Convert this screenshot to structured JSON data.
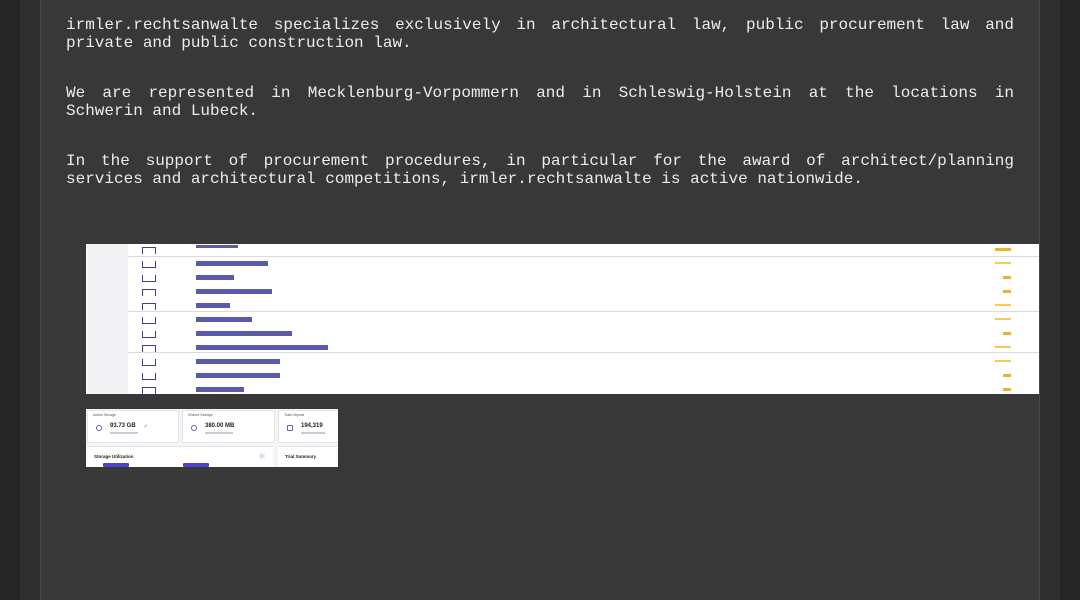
{
  "article": {
    "paragraphs": [
      "irmler.rechtsanwalte specializes exclusively in architectural law, public procurement law and private and public construction law.",
      "We are represented in Mecklenburg-Vorpommern and in Schleswig-Holstein at the locations in Schwerin and Lubeck.",
      "In the support of procurement procedures, in particular for the award of architect/planning services and architectural competitions, irmler.rechtsanwalte is active nationwide."
    ]
  },
  "dashboard_thumb": {
    "cards": [
      {
        "label": "Active Storage",
        "value": "93.73 GB",
        "icon": "cloud-icon"
      },
      {
        "label": "Shared Storage",
        "value": "380.00 MB",
        "icon": "cloud-icon"
      },
      {
        "label": "Total Objects",
        "value": "194,319",
        "icon": "file-icon"
      }
    ],
    "storage_title": "Storage Utilization",
    "trial_title": "Trial Summary"
  },
  "colors": {
    "background": "#383838",
    "text": "#ececec",
    "list_link": "#3d3f9a",
    "flag": "#f0b323",
    "accent": "#4c45c9"
  }
}
